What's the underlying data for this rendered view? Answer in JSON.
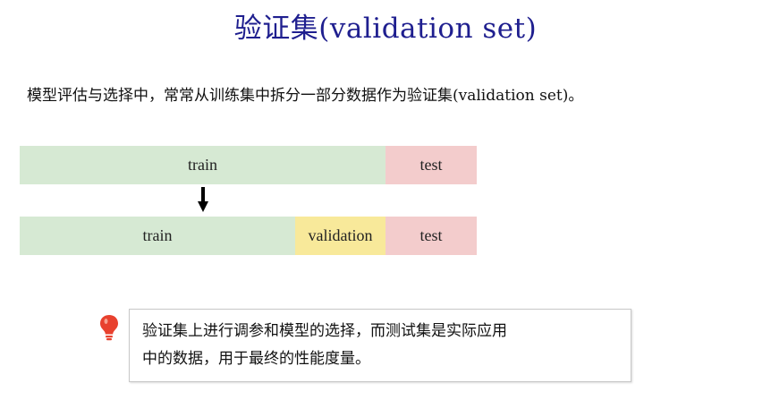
{
  "title": "验证集(validation set)",
  "intro": "模型评估与选择中，常常从训练集中拆分一部分数据作为验证集(validation set)。",
  "split_before": {
    "segments": [
      {
        "label": "train",
        "color": "#d6e9d3"
      },
      {
        "label": "test",
        "color": "#f3cccc"
      }
    ]
  },
  "split_after": {
    "segments": [
      {
        "label": "train",
        "color": "#d6e9d3"
      },
      {
        "label": "validation",
        "color": "#f8e99a"
      },
      {
        "label": "test",
        "color": "#f3cccc"
      }
    ]
  },
  "arrow_icon": "down-arrow-icon",
  "note": {
    "icon": "lightbulb-icon",
    "icon_color": "#e8412e",
    "line1": "验证集上进行调参和模型的选择，而测试集是实际应用",
    "line2": "中的数据，用于最终的性能度量。"
  }
}
